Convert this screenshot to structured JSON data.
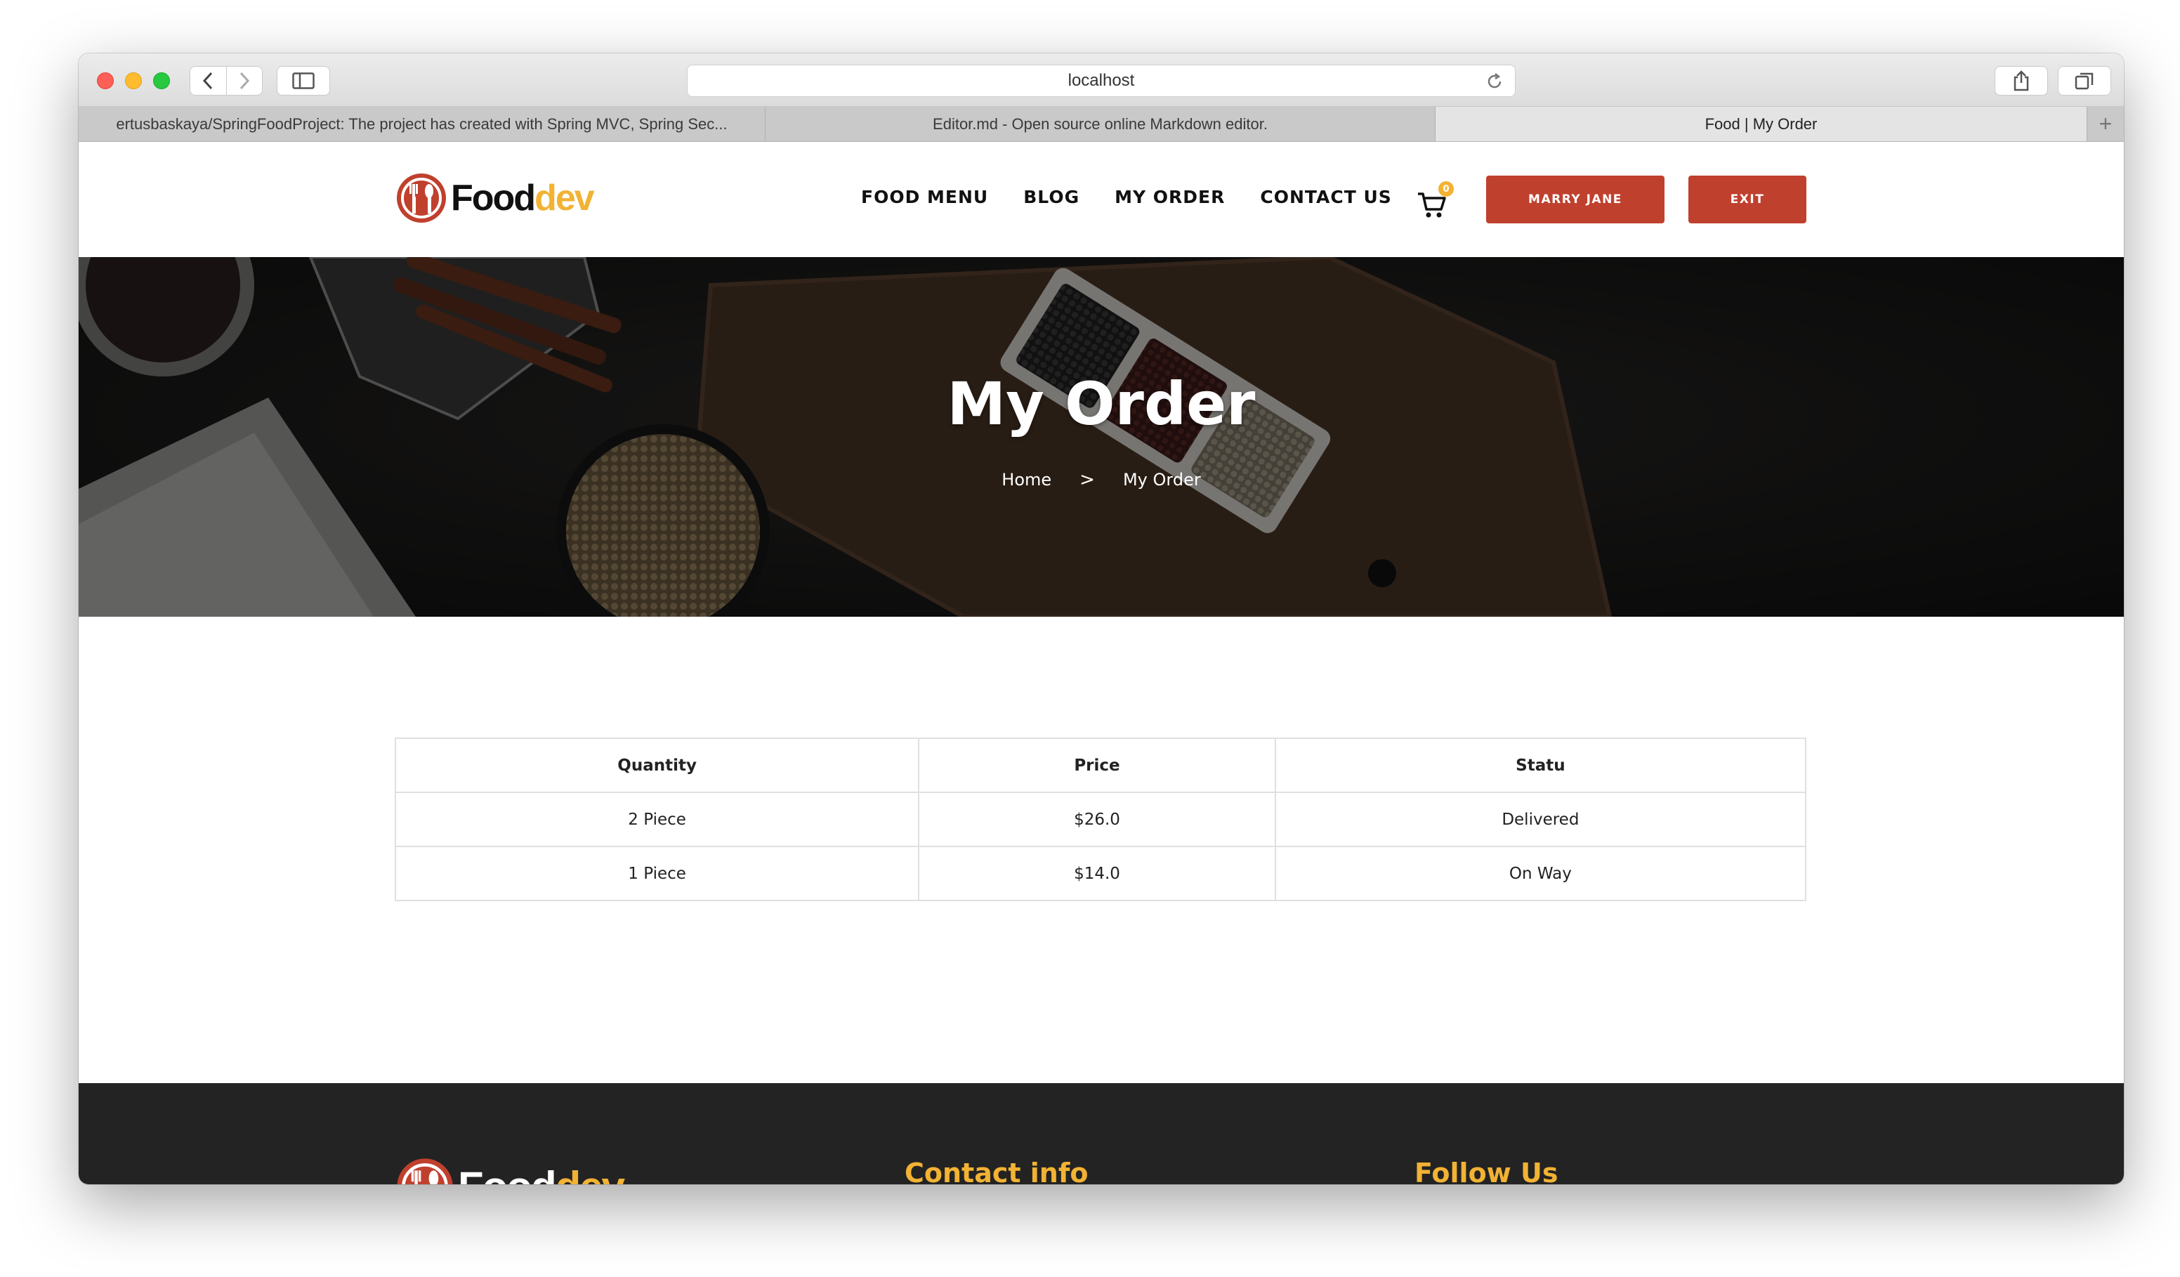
{
  "browser": {
    "address": "localhost",
    "tabs": [
      {
        "title": "ertusbaskaya/SpringFoodProject: The project has created with Spring MVC, Spring Sec..."
      },
      {
        "title": "Editor.md - Open source online Markdown editor."
      },
      {
        "title": "Food | My Order"
      }
    ],
    "new_tab_symbol": "+"
  },
  "site": {
    "logo": {
      "food": "Food",
      "dev": "dev"
    },
    "nav": [
      "FOOD MENU",
      "BLOG",
      "MY ORDER",
      "CONTACT US"
    ],
    "cart_count": "0",
    "user_button": "MARRY JANE",
    "exit_button": "EXIT"
  },
  "hero": {
    "title": "My Order",
    "breadcrumb": {
      "home": "Home",
      "separator": ">",
      "current": "My Order"
    }
  },
  "orders": {
    "headers": {
      "quantity": "Quantity",
      "price": "Price",
      "status": "Statu"
    },
    "rows": [
      {
        "quantity": "2 Piece",
        "price": "$26.0",
        "status": "Delivered"
      },
      {
        "quantity": "1 Piece",
        "price": "$14.0",
        "status": "On Way"
      }
    ]
  },
  "footer": {
    "logo": {
      "food": "Food",
      "dev": "dev"
    },
    "contact_heading": "Contact info",
    "follow_heading": "Follow Us"
  },
  "colors": {
    "accent_red": "#c0402e",
    "accent_yellow": "#f2b233",
    "footer_bg": "#232323"
  }
}
